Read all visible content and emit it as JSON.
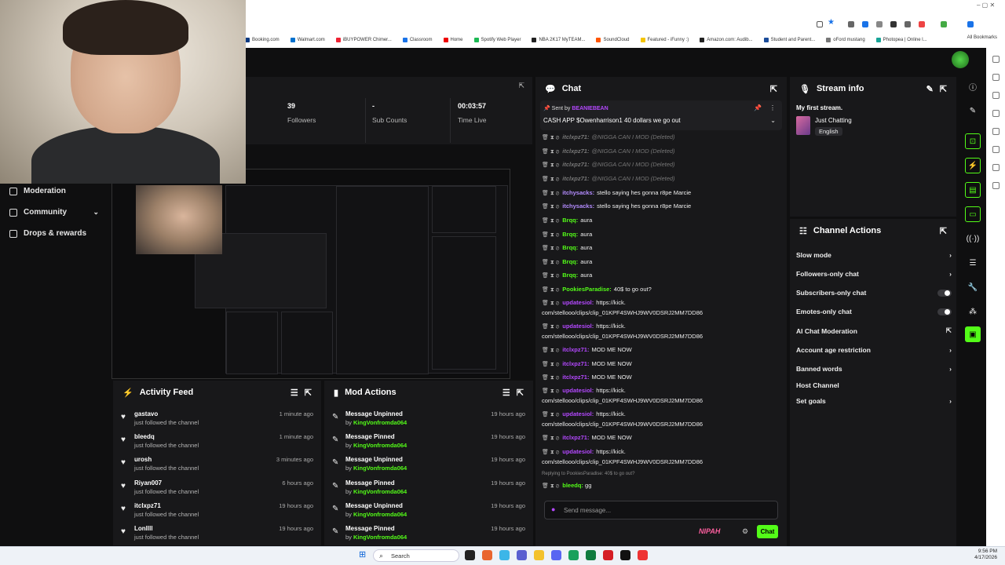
{
  "browser": {
    "bookmarks": [
      "Booking.com",
      "Walmart.com",
      "iBUYPOWER Chimer...",
      "Classroom",
      "Home",
      "Spotify Web Player",
      "NBA 2K17 MyTEAM...",
      "SoundCloud",
      "Featured - iFunny :)",
      "Amazon.com: Audib...",
      "Student and Parent...",
      "oFord mustang",
      "Photopea | Online l..."
    ],
    "bookmark_colors": [
      "#0b3a82",
      "#0071ce",
      "#e23",
      "#1a73e8",
      "#e00",
      "#1db954",
      "#222",
      "#ff5500",
      "#f5c400",
      "#222",
      "#1b4c9a",
      "#777",
      "#18a497"
    ],
    "all_bookmarks": "All Bookmarks"
  },
  "nav": {
    "items": [
      {
        "label": "Moderation",
        "icon": "sword-icon"
      },
      {
        "label": "Community",
        "icon": "people-icon"
      },
      {
        "label": "Drops & rewards",
        "icon": "gift-icon"
      }
    ]
  },
  "stats": {
    "followers_value": "39",
    "followers_label": "Followers",
    "subs_value": "-",
    "subs_label": "Sub Counts",
    "time_value": "00:03:57",
    "time_label": "Time Live"
  },
  "activity_feed": {
    "title": "Activity Feed",
    "items": [
      {
        "name": "gastavo",
        "action": "just followed the channel",
        "time": "1 minute ago"
      },
      {
        "name": "bleedq",
        "action": "just followed the channel",
        "time": "1 minute ago"
      },
      {
        "name": "urosh",
        "action": "just followed the channel",
        "time": "3 minutes ago"
      },
      {
        "name": "Riyan007",
        "action": "just followed the channel",
        "time": "6 hours ago"
      },
      {
        "name": "itclxpz71",
        "action": "just followed the channel",
        "time": "19 hours ago"
      },
      {
        "name": "Lonllll",
        "action": "just followed the channel",
        "time": "19 hours ago"
      }
    ]
  },
  "mod_actions": {
    "title": "Mod Actions",
    "items": [
      {
        "action": "Message Unpinned",
        "by": "by",
        "user": "KingVonfromda064",
        "time": "19 hours ago"
      },
      {
        "action": "Message Pinned",
        "by": "by",
        "user": "KingVonfromda064",
        "time": "19 hours ago"
      },
      {
        "action": "Message Unpinned",
        "by": "by",
        "user": "KingVonfromda064",
        "time": "19 hours ago"
      },
      {
        "action": "Message Pinned",
        "by": "by",
        "user": "KingVonfromda064",
        "time": "19 hours ago"
      },
      {
        "action": "Message Unpinned",
        "by": "by",
        "user": "KingVonfromda064",
        "time": "19 hours ago"
      },
      {
        "action": "Message Pinned",
        "by": "by",
        "user": "KingVonfromda064",
        "time": "19 hours ago"
      }
    ]
  },
  "chat": {
    "title": "Chat",
    "pinned_sent_by": "Sent by",
    "pinned_user": "BEANIEBEAN",
    "pinned_text": "CASH APP $Owenharrison1 40 dollars we go out",
    "messages": [
      {
        "user": "itclxpz71:",
        "text": "@NIGGA CAN I MOD (Deleted)",
        "color": "#777",
        "deleted": true
      },
      {
        "user": "itclxpz71:",
        "text": "@NIGGA CAN I MOD (Deleted)",
        "color": "#777",
        "deleted": true
      },
      {
        "user": "itclxpz71:",
        "text": "@NIGGA CAN I MOD (Deleted)",
        "color": "#777",
        "deleted": true
      },
      {
        "user": "itclxpz71:",
        "text": "@NIGGA CAN I MOD (Deleted)",
        "color": "#777",
        "deleted": true
      },
      {
        "user": "itchysacks:",
        "text": "stello saying hes gonna r8pe Marcie",
        "color": "#b48cff",
        "deleted": false
      },
      {
        "user": "itchysacks:",
        "text": "stello saying hes gonna r8pe Marcie",
        "color": "#b48cff",
        "deleted": false
      },
      {
        "user": "Brqq:",
        "text": "aura",
        "color": "#53fc18",
        "deleted": false
      },
      {
        "user": "Brqq:",
        "text": "aura",
        "color": "#53fc18",
        "deleted": false
      },
      {
        "user": "Brqq:",
        "text": "aura",
        "color": "#53fc18",
        "deleted": false
      },
      {
        "user": "Brqq:",
        "text": "aura",
        "color": "#53fc18",
        "deleted": false
      },
      {
        "user": "Brqq:",
        "text": "aura",
        "color": "#53fc18",
        "deleted": false
      },
      {
        "user": "PookiesParadise:",
        "text": "40$ to go out?",
        "color": "#53fc18",
        "deleted": false
      },
      {
        "user": "updatesiol:",
        "text": "https://kick.",
        "cont": "com/stellooo/clips/clip_01KPF4SWHJ9WV0DSRJ2MM7DD86",
        "color": "#b448ff",
        "deleted": false
      },
      {
        "user": "updatesiol:",
        "text": "https://kick.",
        "cont": "com/stellooo/clips/clip_01KPF4SWHJ9WV0DSRJ2MM7DD86",
        "color": "#b448ff",
        "deleted": false
      },
      {
        "user": "itclxpz71:",
        "text": "MOD ME NOW",
        "color": "#b448ff",
        "deleted": false
      },
      {
        "user": "itclxpz71:",
        "text": "MOD ME NOW",
        "color": "#b448ff",
        "deleted": false
      },
      {
        "user": "itclxpz71:",
        "text": "MOD ME NOW",
        "color": "#b448ff",
        "deleted": false
      },
      {
        "user": "updatesiol:",
        "text": "https://kick.",
        "cont": "com/stellooo/clips/clip_01KPF4SWHJ9WV0DSRJ2MM7DD86",
        "color": "#b448ff",
        "deleted": false
      },
      {
        "user": "updatesiol:",
        "text": "https://kick.",
        "cont": "com/stellooo/clips/clip_01KPF4SWHJ9WV0DSRJ2MM7DD86",
        "color": "#b448ff",
        "deleted": false
      },
      {
        "user": "itclxpz71:",
        "text": "MOD ME NOW",
        "color": "#b448ff",
        "deleted": false
      },
      {
        "user": "updatesiol:",
        "text": "https://kick.",
        "cont": "com/stellooo/clips/clip_01KPF4SWHJ9WV0DSRJ2MM7DD86",
        "color": "#b448ff",
        "deleted": false
      }
    ],
    "reply_note": "Replying to PookiesParadise: 40$ to go out?",
    "last_user": "bleedq:",
    "last_text": "gg",
    "input_placeholder": "Send message...",
    "send_label": "Chat",
    "brand_label": "NIPAH"
  },
  "stream_info": {
    "title": "Stream info",
    "stream_title": "My first stream.",
    "category": "Just Chatting",
    "language": "English"
  },
  "channel_actions": {
    "title": "Channel Actions",
    "items": [
      {
        "label": "Slow mode",
        "control": "chevron"
      },
      {
        "label": "Followers-only chat",
        "control": "chevron"
      },
      {
        "label": "Subscribers-only chat",
        "control": "toggle"
      },
      {
        "label": "Emotes-only chat",
        "control": "toggle"
      },
      {
        "label": "AI Chat Moderation",
        "control": "external"
      },
      {
        "label": "Account age restriction",
        "control": "chevron"
      },
      {
        "label": "Banned words",
        "control": "chevron"
      },
      {
        "label": "Host Channel",
        "control": "none"
      },
      {
        "label": "Set goals",
        "control": "chevron"
      }
    ]
  },
  "taskbar": {
    "search_label": "Search",
    "time": "9:56 PM",
    "date": "4/17/2026"
  },
  "colors": {
    "accent": "#53fc18",
    "panel": "#18181a",
    "background": "#0f0f10"
  }
}
